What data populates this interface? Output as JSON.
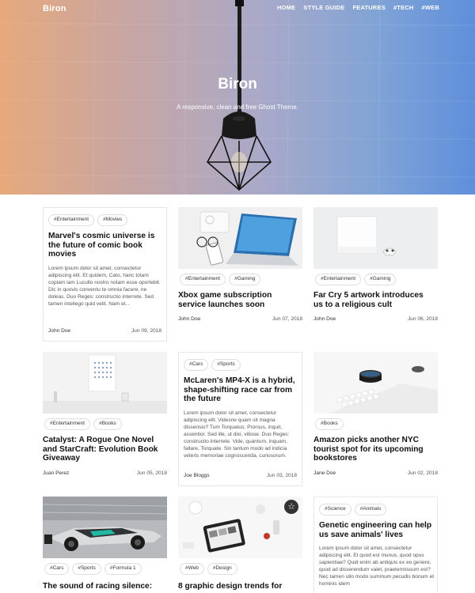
{
  "header": {
    "brand": "Biron",
    "nav": [
      "HOME",
      "STYLE GUIDE",
      "FEATURES",
      "#TECH",
      "#WEB"
    ],
    "title": "Biron",
    "subtitle": "A responsive, clean and free Ghost Theme."
  },
  "posts": [
    {
      "tags": [
        "#Entertainment",
        "#Movies"
      ],
      "title": "Marvel's cosmic universe is the future of comic book movies",
      "excerpt": "Lorem ipsum dolor sit amet, consectetur adipiscing elit. Et quidem, Cato, hanc totam copiam iam Lucullo nostro notam esse oportebit. Dic in quovis conventu te omnia facere, ne doleas. Duo Reges: constructio interrete. Sed tamen intellego quid velit. Nam et...",
      "author": "John Doe",
      "date": "Jun 09, 2018"
    },
    {
      "tags": [
        "#Entertainment",
        "#Gaming"
      ],
      "title": "Xbox game subscription service launches soon",
      "author": "John Doe",
      "date": "Jun 07, 2018"
    },
    {
      "tags": [
        "#Entertainment",
        "#Gaming"
      ],
      "title": "Far Cry 5 artwork introduces us to a religious cult",
      "author": "John Doe",
      "date": "Jun 06, 2018"
    },
    {
      "tags": [
        "#Entertainment",
        "#Books"
      ],
      "title": "Catalyst: A Rogue One Novel and StarCraft: Evolution Book Giveaway",
      "author": "Juan Perez",
      "date": "Jun 05, 2018"
    },
    {
      "tags": [
        "#Cars",
        "#Sports"
      ],
      "title": "McLaren's MP4-X is a hybrid, shape-shifting race car from the future",
      "excerpt": "Lorem ipsum dolor sit amet, consectetur adipiscing elit. Videsne quam sit magna dissensio? Tum Torquatus: Prorsus, inquit, assentior. Sed ille, ut dixi, vitiose. Duo Reges: constructio interrete. Vide, quantum, inquam, fallare, Torquate. Sin tantum modo ad indicia veteris memoriae cognoscenda, curiosorum.",
      "author": "Joe Bloggs",
      "date": "Jun 03, 2018"
    },
    {
      "tags": [
        "#Books"
      ],
      "title": "Amazon picks another NYC tourist spot for its upcoming bookstores",
      "author": "Jane Doe",
      "date": "Jun 02, 2018"
    },
    {
      "tags": [
        "#Cars",
        "#Sports",
        "#Formula 1"
      ],
      "title": "The sound of racing silence:"
    },
    {
      "tags": [
        "#Web",
        "#Design"
      ],
      "title": "8 graphic design trends for",
      "featured_icon": "star-icon"
    },
    {
      "tags": [
        "#Science",
        "#Animals"
      ],
      "title": "Genetic engineering can help us save animals' lives",
      "excerpt": "Lorem ipsum dolor sit amet, consectetur adipiscing elit. Et quod est munus, quod opus sapientiae? Quid enim ab antiquis ex eo genere, quod ad disserendum valet, praetermissum est? Nec tamen ullo modo summum pecudis bonum et hominis idem"
    }
  ]
}
